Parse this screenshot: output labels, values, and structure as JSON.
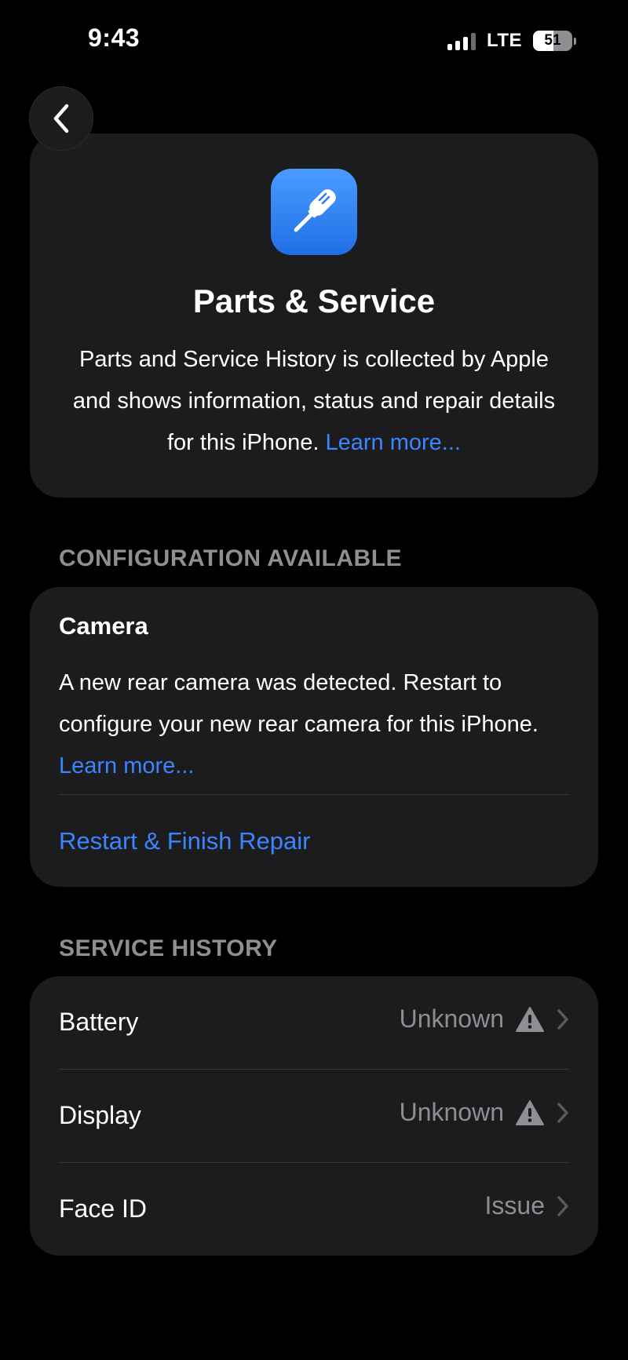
{
  "status_bar": {
    "time": "9:43",
    "network": "LTE",
    "battery_level": "51",
    "battery_fraction": 0.51
  },
  "icons": {
    "back": "chevron-left-icon",
    "app": "screwdriver-icon",
    "warning": "warning-triangle-icon",
    "disclosure": "chevron-right-icon"
  },
  "colors": {
    "background": "#000000",
    "card": "#1c1c1e",
    "link": "#3a86ff",
    "secondary_text": "#8e8e93",
    "icon_gradient_top": "#4a9cff",
    "icon_gradient_bottom": "#1f6fe5"
  },
  "hero": {
    "title": "Parts & Service",
    "description": "Parts and Service History is collected by Apple and shows information, status and repair details for this iPhone. ",
    "learn_more": "Learn more..."
  },
  "configuration": {
    "header": "CONFIGURATION AVAILABLE",
    "title": "Camera",
    "description": "A new rear camera was detected. Restart to configure your new rear camera for this iPhone. ",
    "learn_more": "Learn more...",
    "action": "Restart & Finish Repair"
  },
  "service_history": {
    "header": "SERVICE HISTORY",
    "items": [
      {
        "label": "Battery",
        "value": "Unknown",
        "warning": true
      },
      {
        "label": "Display",
        "value": "Unknown",
        "warning": true
      },
      {
        "label": "Face ID",
        "value": "Issue",
        "warning": false
      }
    ]
  }
}
